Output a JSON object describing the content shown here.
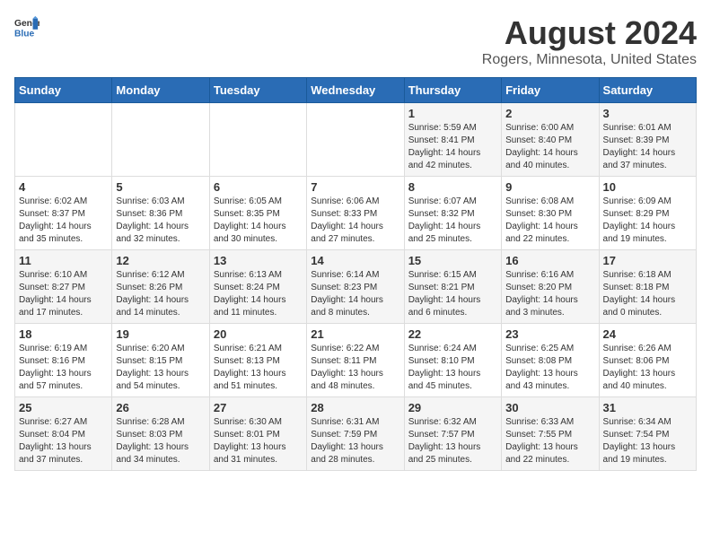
{
  "header": {
    "logo_general": "General",
    "logo_blue": "Blue",
    "title": "August 2024",
    "subtitle": "Rogers, Minnesota, United States"
  },
  "days_of_week": [
    "Sunday",
    "Monday",
    "Tuesday",
    "Wednesday",
    "Thursday",
    "Friday",
    "Saturday"
  ],
  "weeks": [
    [
      {
        "day": "",
        "info": ""
      },
      {
        "day": "",
        "info": ""
      },
      {
        "day": "",
        "info": ""
      },
      {
        "day": "",
        "info": ""
      },
      {
        "day": "1",
        "info": "Sunrise: 5:59 AM\nSunset: 8:41 PM\nDaylight: 14 hours\nand 42 minutes."
      },
      {
        "day": "2",
        "info": "Sunrise: 6:00 AM\nSunset: 8:40 PM\nDaylight: 14 hours\nand 40 minutes."
      },
      {
        "day": "3",
        "info": "Sunrise: 6:01 AM\nSunset: 8:39 PM\nDaylight: 14 hours\nand 37 minutes."
      }
    ],
    [
      {
        "day": "4",
        "info": "Sunrise: 6:02 AM\nSunset: 8:37 PM\nDaylight: 14 hours\nand 35 minutes."
      },
      {
        "day": "5",
        "info": "Sunrise: 6:03 AM\nSunset: 8:36 PM\nDaylight: 14 hours\nand 32 minutes."
      },
      {
        "day": "6",
        "info": "Sunrise: 6:05 AM\nSunset: 8:35 PM\nDaylight: 14 hours\nand 30 minutes."
      },
      {
        "day": "7",
        "info": "Sunrise: 6:06 AM\nSunset: 8:33 PM\nDaylight: 14 hours\nand 27 minutes."
      },
      {
        "day": "8",
        "info": "Sunrise: 6:07 AM\nSunset: 8:32 PM\nDaylight: 14 hours\nand 25 minutes."
      },
      {
        "day": "9",
        "info": "Sunrise: 6:08 AM\nSunset: 8:30 PM\nDaylight: 14 hours\nand 22 minutes."
      },
      {
        "day": "10",
        "info": "Sunrise: 6:09 AM\nSunset: 8:29 PM\nDaylight: 14 hours\nand 19 minutes."
      }
    ],
    [
      {
        "day": "11",
        "info": "Sunrise: 6:10 AM\nSunset: 8:27 PM\nDaylight: 14 hours\nand 17 minutes."
      },
      {
        "day": "12",
        "info": "Sunrise: 6:12 AM\nSunset: 8:26 PM\nDaylight: 14 hours\nand 14 minutes."
      },
      {
        "day": "13",
        "info": "Sunrise: 6:13 AM\nSunset: 8:24 PM\nDaylight: 14 hours\nand 11 minutes."
      },
      {
        "day": "14",
        "info": "Sunrise: 6:14 AM\nSunset: 8:23 PM\nDaylight: 14 hours\nand 8 minutes."
      },
      {
        "day": "15",
        "info": "Sunrise: 6:15 AM\nSunset: 8:21 PM\nDaylight: 14 hours\nand 6 minutes."
      },
      {
        "day": "16",
        "info": "Sunrise: 6:16 AM\nSunset: 8:20 PM\nDaylight: 14 hours\nand 3 minutes."
      },
      {
        "day": "17",
        "info": "Sunrise: 6:18 AM\nSunset: 8:18 PM\nDaylight: 14 hours\nand 0 minutes."
      }
    ],
    [
      {
        "day": "18",
        "info": "Sunrise: 6:19 AM\nSunset: 8:16 PM\nDaylight: 13 hours\nand 57 minutes."
      },
      {
        "day": "19",
        "info": "Sunrise: 6:20 AM\nSunset: 8:15 PM\nDaylight: 13 hours\nand 54 minutes."
      },
      {
        "day": "20",
        "info": "Sunrise: 6:21 AM\nSunset: 8:13 PM\nDaylight: 13 hours\nand 51 minutes."
      },
      {
        "day": "21",
        "info": "Sunrise: 6:22 AM\nSunset: 8:11 PM\nDaylight: 13 hours\nand 48 minutes."
      },
      {
        "day": "22",
        "info": "Sunrise: 6:24 AM\nSunset: 8:10 PM\nDaylight: 13 hours\nand 45 minutes."
      },
      {
        "day": "23",
        "info": "Sunrise: 6:25 AM\nSunset: 8:08 PM\nDaylight: 13 hours\nand 43 minutes."
      },
      {
        "day": "24",
        "info": "Sunrise: 6:26 AM\nSunset: 8:06 PM\nDaylight: 13 hours\nand 40 minutes."
      }
    ],
    [
      {
        "day": "25",
        "info": "Sunrise: 6:27 AM\nSunset: 8:04 PM\nDaylight: 13 hours\nand 37 minutes."
      },
      {
        "day": "26",
        "info": "Sunrise: 6:28 AM\nSunset: 8:03 PM\nDaylight: 13 hours\nand 34 minutes."
      },
      {
        "day": "27",
        "info": "Sunrise: 6:30 AM\nSunset: 8:01 PM\nDaylight: 13 hours\nand 31 minutes."
      },
      {
        "day": "28",
        "info": "Sunrise: 6:31 AM\nSunset: 7:59 PM\nDaylight: 13 hours\nand 28 minutes."
      },
      {
        "day": "29",
        "info": "Sunrise: 6:32 AM\nSunset: 7:57 PM\nDaylight: 13 hours\nand 25 minutes."
      },
      {
        "day": "30",
        "info": "Sunrise: 6:33 AM\nSunset: 7:55 PM\nDaylight: 13 hours\nand 22 minutes."
      },
      {
        "day": "31",
        "info": "Sunrise: 6:34 AM\nSunset: 7:54 PM\nDaylight: 13 hours\nand 19 minutes."
      }
    ]
  ]
}
